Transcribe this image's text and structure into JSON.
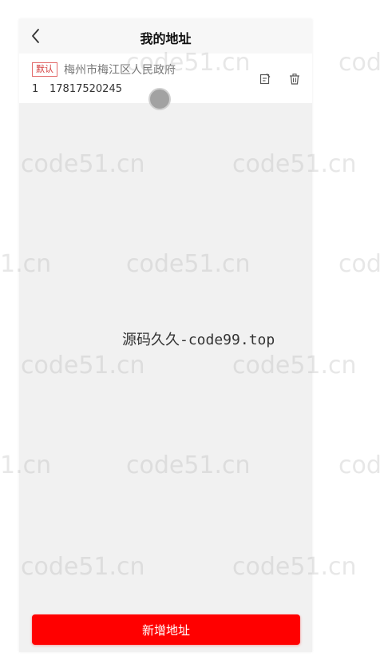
{
  "header": {
    "title": "我的地址"
  },
  "address": {
    "badge": "默认",
    "detail": "梅州市梅江区人民政府",
    "name": "1",
    "phone": "17817520245"
  },
  "footer": {
    "add_label": "新增地址"
  },
  "watermarks": {
    "repeat_text": "code51.cn",
    "cut_text": "1.cn",
    "center_text": "源码久久-code99.top"
  },
  "colors": {
    "accent": "#ff0000",
    "badge": "#d33b3b",
    "background": "#f1f1f1"
  },
  "icons": {
    "back": "chevron-left-icon",
    "edit": "edit-icon",
    "delete": "trash-icon"
  }
}
